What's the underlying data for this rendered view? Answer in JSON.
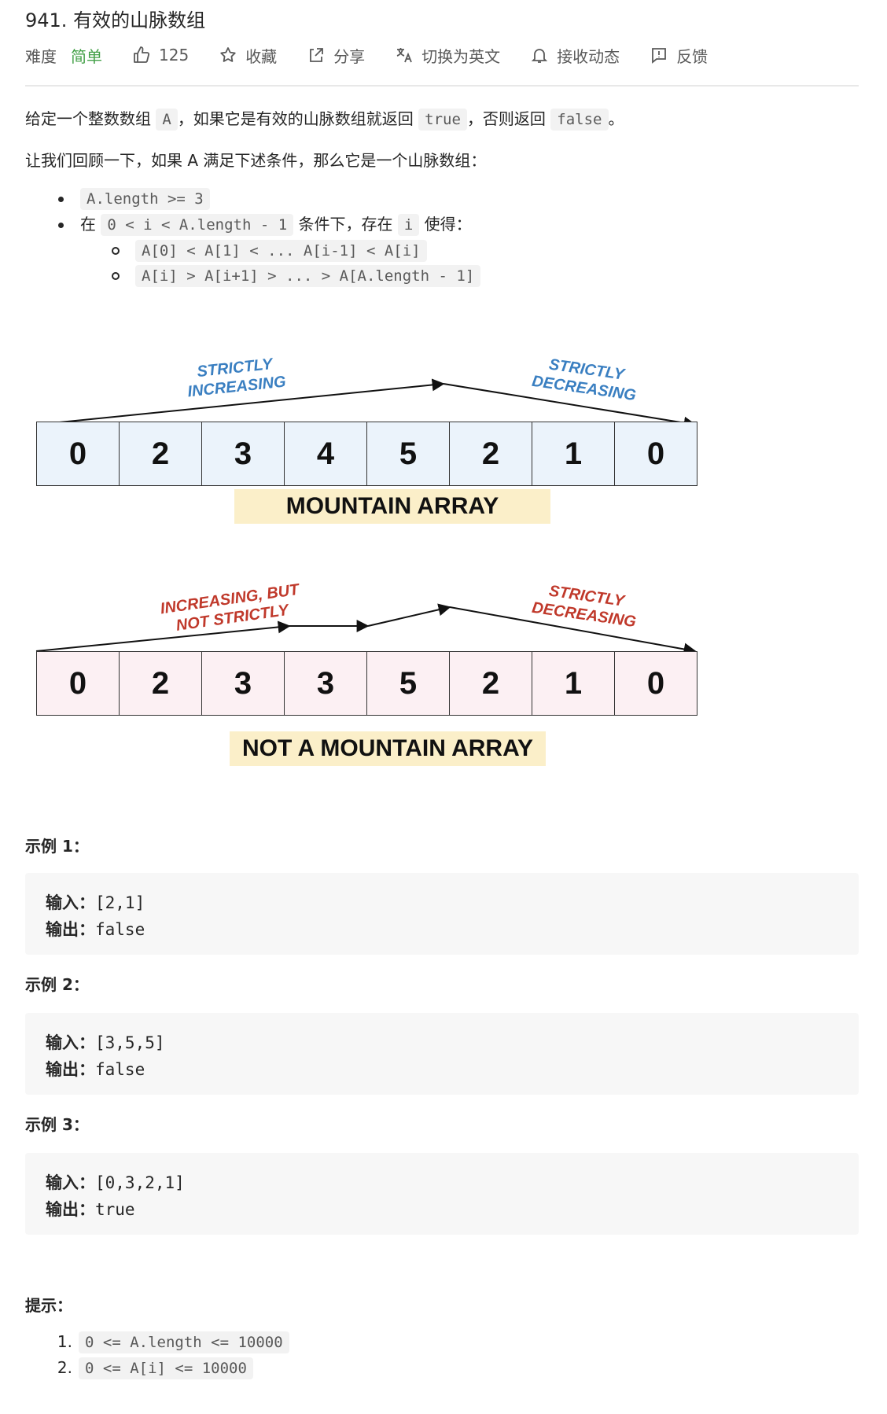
{
  "header": {
    "title": "941. 有效的山脉数组",
    "difficulty_label": "难度",
    "difficulty_value": "简单",
    "likes": "125",
    "favorite": "收藏",
    "share": "分享",
    "translate": "切换为英文",
    "subscribe": "接收动态",
    "feedback": "反馈"
  },
  "description": {
    "intro_a": "给定一个整数数组 ",
    "intro_code_a": "A",
    "intro_b": "，如果它是有效的山脉数组就返回 ",
    "intro_code_true": "true",
    "intro_c": "，否则返回 ",
    "intro_code_false": "false",
    "intro_d": "。",
    "recall": "让我们回顾一下，如果 A 满足下述条件，那么它是一个山脉数组：",
    "cond1_code": "A.length >= 3",
    "cond2_pre": "在 ",
    "cond2_code": "0 < i < A.length - 1",
    "cond2_mid": " 条件下，存在 ",
    "cond2_code_i": "i",
    "cond2_post": " 使得：",
    "sub1_code": "A[0] < A[1] < ... A[i-1] < A[i]",
    "sub2_code": "A[i] > A[i+1] > ... > A[A.length - 1]"
  },
  "figure1": {
    "values": [
      "0",
      "2",
      "3",
      "4",
      "5",
      "2",
      "1",
      "0"
    ],
    "left_label_1": "STRICTLY",
    "left_label_2": "INCREASING",
    "right_label_1": "STRICTLY",
    "right_label_2": "DECREASING",
    "banner": "MOUNTAIN ARRAY",
    "cell_color": "#ebf3fb",
    "label_color": "#3a7fc1"
  },
  "figure2": {
    "values": [
      "0",
      "2",
      "3",
      "3",
      "5",
      "2",
      "1",
      "0"
    ],
    "left_label_1": "INCREASING, BUT",
    "left_label_2": "NOT STRICTLY",
    "right_label_1": "STRICTLY",
    "right_label_2": "DECREASING",
    "banner": "NOT A MOUNTAIN ARRAY",
    "cell_color": "#fcf0f3",
    "label_color": "#c0392b"
  },
  "examples": [
    {
      "heading": "示例 1：",
      "input_label": "输入：",
      "input": "[2,1]",
      "output_label": "输出：",
      "output": "false"
    },
    {
      "heading": "示例 2：",
      "input_label": "输入：",
      "input": "[3,5,5]",
      "output_label": "输出：",
      "output": "false"
    },
    {
      "heading": "示例 3：",
      "input_label": "输入：",
      "input": "[0,3,2,1]",
      "output_label": "输出：",
      "output": "true"
    }
  ],
  "hints": {
    "heading": "提示：",
    "items": [
      {
        "num": "1.",
        "code": "0 <= A.length <= 10000"
      },
      {
        "num": "2.",
        "code": "0 <= A[i] <= 10000"
      }
    ]
  }
}
